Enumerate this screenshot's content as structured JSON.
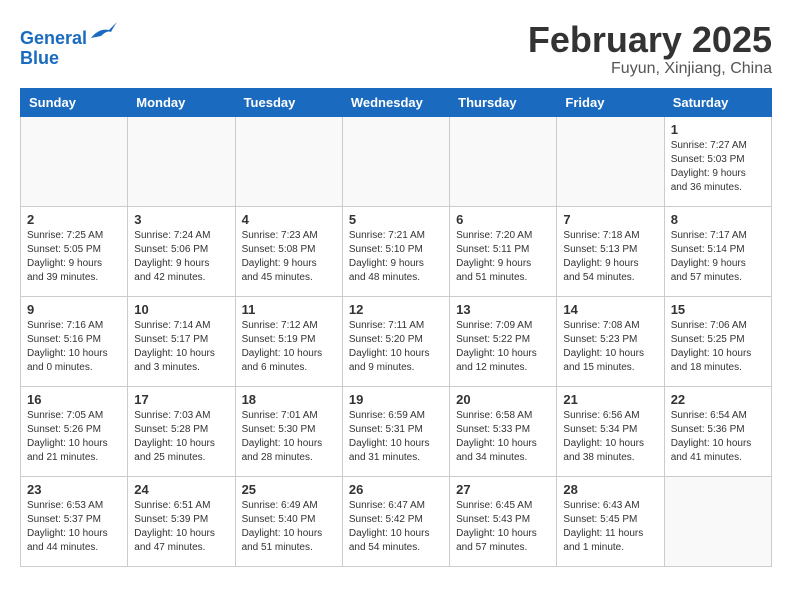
{
  "header": {
    "logo_line1": "General",
    "logo_line2": "Blue",
    "title": "February 2025",
    "subtitle": "Fuyun, Xinjiang, China"
  },
  "weekdays": [
    "Sunday",
    "Monday",
    "Tuesday",
    "Wednesday",
    "Thursday",
    "Friday",
    "Saturday"
  ],
  "weeks": [
    [
      {
        "num": "",
        "info": ""
      },
      {
        "num": "",
        "info": ""
      },
      {
        "num": "",
        "info": ""
      },
      {
        "num": "",
        "info": ""
      },
      {
        "num": "",
        "info": ""
      },
      {
        "num": "",
        "info": ""
      },
      {
        "num": "1",
        "info": "Sunrise: 7:27 AM\nSunset: 5:03 PM\nDaylight: 9 hours and 36 minutes."
      }
    ],
    [
      {
        "num": "2",
        "info": "Sunrise: 7:25 AM\nSunset: 5:05 PM\nDaylight: 9 hours and 39 minutes."
      },
      {
        "num": "3",
        "info": "Sunrise: 7:24 AM\nSunset: 5:06 PM\nDaylight: 9 hours and 42 minutes."
      },
      {
        "num": "4",
        "info": "Sunrise: 7:23 AM\nSunset: 5:08 PM\nDaylight: 9 hours and 45 minutes."
      },
      {
        "num": "5",
        "info": "Sunrise: 7:21 AM\nSunset: 5:10 PM\nDaylight: 9 hours and 48 minutes."
      },
      {
        "num": "6",
        "info": "Sunrise: 7:20 AM\nSunset: 5:11 PM\nDaylight: 9 hours and 51 minutes."
      },
      {
        "num": "7",
        "info": "Sunrise: 7:18 AM\nSunset: 5:13 PM\nDaylight: 9 hours and 54 minutes."
      },
      {
        "num": "8",
        "info": "Sunrise: 7:17 AM\nSunset: 5:14 PM\nDaylight: 9 hours and 57 minutes."
      }
    ],
    [
      {
        "num": "9",
        "info": "Sunrise: 7:16 AM\nSunset: 5:16 PM\nDaylight: 10 hours and 0 minutes."
      },
      {
        "num": "10",
        "info": "Sunrise: 7:14 AM\nSunset: 5:17 PM\nDaylight: 10 hours and 3 minutes."
      },
      {
        "num": "11",
        "info": "Sunrise: 7:12 AM\nSunset: 5:19 PM\nDaylight: 10 hours and 6 minutes."
      },
      {
        "num": "12",
        "info": "Sunrise: 7:11 AM\nSunset: 5:20 PM\nDaylight: 10 hours and 9 minutes."
      },
      {
        "num": "13",
        "info": "Sunrise: 7:09 AM\nSunset: 5:22 PM\nDaylight: 10 hours and 12 minutes."
      },
      {
        "num": "14",
        "info": "Sunrise: 7:08 AM\nSunset: 5:23 PM\nDaylight: 10 hours and 15 minutes."
      },
      {
        "num": "15",
        "info": "Sunrise: 7:06 AM\nSunset: 5:25 PM\nDaylight: 10 hours and 18 minutes."
      }
    ],
    [
      {
        "num": "16",
        "info": "Sunrise: 7:05 AM\nSunset: 5:26 PM\nDaylight: 10 hours and 21 minutes."
      },
      {
        "num": "17",
        "info": "Sunrise: 7:03 AM\nSunset: 5:28 PM\nDaylight: 10 hours and 25 minutes."
      },
      {
        "num": "18",
        "info": "Sunrise: 7:01 AM\nSunset: 5:30 PM\nDaylight: 10 hours and 28 minutes."
      },
      {
        "num": "19",
        "info": "Sunrise: 6:59 AM\nSunset: 5:31 PM\nDaylight: 10 hours and 31 minutes."
      },
      {
        "num": "20",
        "info": "Sunrise: 6:58 AM\nSunset: 5:33 PM\nDaylight: 10 hours and 34 minutes."
      },
      {
        "num": "21",
        "info": "Sunrise: 6:56 AM\nSunset: 5:34 PM\nDaylight: 10 hours and 38 minutes."
      },
      {
        "num": "22",
        "info": "Sunrise: 6:54 AM\nSunset: 5:36 PM\nDaylight: 10 hours and 41 minutes."
      }
    ],
    [
      {
        "num": "23",
        "info": "Sunrise: 6:53 AM\nSunset: 5:37 PM\nDaylight: 10 hours and 44 minutes."
      },
      {
        "num": "24",
        "info": "Sunrise: 6:51 AM\nSunset: 5:39 PM\nDaylight: 10 hours and 47 minutes."
      },
      {
        "num": "25",
        "info": "Sunrise: 6:49 AM\nSunset: 5:40 PM\nDaylight: 10 hours and 51 minutes."
      },
      {
        "num": "26",
        "info": "Sunrise: 6:47 AM\nSunset: 5:42 PM\nDaylight: 10 hours and 54 minutes."
      },
      {
        "num": "27",
        "info": "Sunrise: 6:45 AM\nSunset: 5:43 PM\nDaylight: 10 hours and 57 minutes."
      },
      {
        "num": "28",
        "info": "Sunrise: 6:43 AM\nSunset: 5:45 PM\nDaylight: 11 hours and 1 minute."
      },
      {
        "num": "",
        "info": ""
      }
    ]
  ]
}
